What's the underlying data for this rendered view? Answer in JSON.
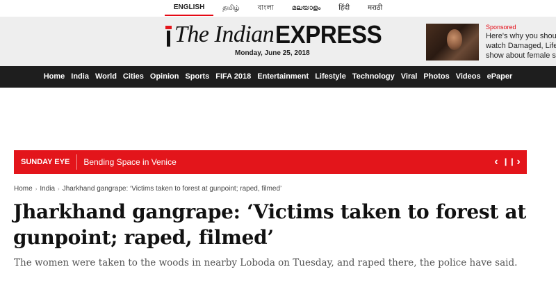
{
  "languages": [
    "ENGLISH",
    "தமிழ்",
    "বাংলা",
    "മലയാളം",
    "हिंदी",
    "मराठी"
  ],
  "masthead": {
    "logo_the": "The Indian",
    "logo_express": "EXPRESS",
    "date": "Monday, June 25, 2018"
  },
  "ad": {
    "sponsored": "Sponsored",
    "lines": [
      "Here's why you shoul",
      "watch Damaged, Lifeti",
      "show about female se"
    ]
  },
  "nav": [
    "Home",
    "India",
    "World",
    "Cities",
    "Opinion",
    "Sports",
    "FIFA 2018",
    "Entertainment",
    "Lifestyle",
    "Technology",
    "Viral",
    "Photos",
    "Videos",
    "ePaper"
  ],
  "ticker": {
    "label": "SUNDAY EYE",
    "text": "Bending Space in Venice",
    "prev": "‹",
    "pause": "❙❙",
    "next": "›"
  },
  "breadcrumb": {
    "items": [
      "Home",
      "India",
      "Jharkhand gangrape: ‘Victims taken to forest at gunpoint; raped, filmed’"
    ]
  },
  "article": {
    "headline": "Jharkhand gangrape: ‘Victims taken to forest at gunpoint; raped, filmed’",
    "subhead": "The women were taken to the woods in nearby Loboda on Tuesday, and raped there, the police have said."
  },
  "colors": {
    "accent_red": "#e3151b",
    "nav_bg": "#1e1e1e",
    "masthead_bg": "#eeeeee"
  }
}
